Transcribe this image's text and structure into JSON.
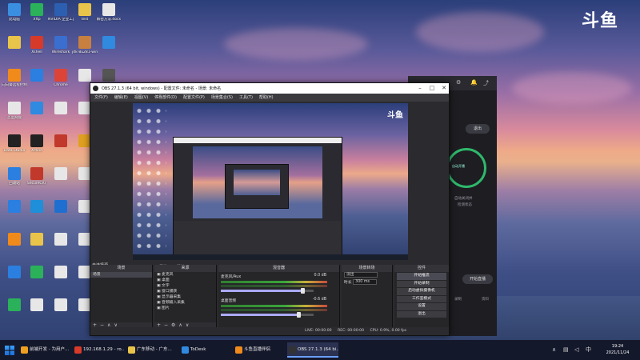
{
  "brand_logo": "斗鱼",
  "desktop_icons": [
    {
      "label": "此电脑",
      "color": "#3b8fe0"
    },
    {
      "label": "Xftp",
      "color": "#2bb15a"
    },
    {
      "label": "NVIDIA 企业工具",
      "color": "#2d5fb0"
    },
    {
      "label": "test",
      "color": "#e9c44a"
    },
    {
      "label": "解密方法.docx",
      "color": "#e7e7e7"
    },
    {
      "label": "",
      "color": "#e9c44a"
    },
    {
      "label": "Xshell",
      "color": "#d83a2a"
    },
    {
      "label": "Wireshark",
      "color": "#3a6fd0"
    },
    {
      "label": "jdk-8u281-windows",
      "color": "#c78040"
    },
    {
      "label": "",
      "color": "#2f8ae0"
    },
    {
      "label": "向日葵远程控制",
      "color": "#f08a1b"
    },
    {
      "label": "",
      "color": "#2a7fe0"
    },
    {
      "label": "Chrome",
      "color": "#db4437"
    },
    {
      "label": "",
      "color": "#e7e7e7"
    },
    {
      "label": "",
      "color": "#555"
    },
    {
      "label": "百度网盘",
      "color": "#e7e7e7"
    },
    {
      "label": "",
      "color": "#2f8ae0"
    },
    {
      "label": "",
      "color": "#e7e7e7"
    },
    {
      "label": "",
      "color": "#e7e7e7"
    },
    {
      "label": "",
      "color": "#555"
    },
    {
      "label": "Data Studio",
      "color": "#222"
    },
    {
      "label": "XMind",
      "color": "#222"
    },
    {
      "label": "",
      "color": "#c0392b"
    },
    {
      "label": "",
      "color": "#e0a020"
    },
    {
      "label": "",
      "color": "#555"
    },
    {
      "label": "回收站",
      "color": "#2a7fe0"
    },
    {
      "label": "SecureCRT",
      "color": "#c0392b"
    },
    {
      "label": "",
      "color": "#e7e7e7"
    },
    {
      "label": "",
      "color": "#e7e7e7"
    },
    {
      "label": "",
      "color": "#555"
    },
    {
      "label": "",
      "color": "#2a7fe0"
    },
    {
      "label": "",
      "color": "#1e8fd8"
    },
    {
      "label": "",
      "color": "#1e6fd0"
    },
    {
      "label": "",
      "color": "#e7e7e7"
    },
    {
      "label": "",
      "color": "#c0392b"
    },
    {
      "label": "",
      "color": "#f08a1b"
    },
    {
      "label": "",
      "color": "#e9c44a"
    },
    {
      "label": "",
      "color": "#e7e7e7"
    },
    {
      "label": "",
      "color": "#e7e7e7"
    },
    {
      "label": "",
      "color": "#555"
    },
    {
      "label": "",
      "color": "#2a7fe0"
    },
    {
      "label": "",
      "color": "#2bb15a"
    },
    {
      "label": "",
      "color": "#e7e7e7"
    },
    {
      "label": "",
      "color": "#e7e7e7"
    },
    {
      "label": "",
      "color": "#555"
    },
    {
      "label": "",
      "color": "#2bb15a"
    },
    {
      "label": "",
      "color": "#e7e7e7"
    },
    {
      "label": "",
      "color": "#e7e7e7"
    },
    {
      "label": "",
      "color": "#e7e7e7"
    },
    {
      "label": "",
      "color": "#1e6fd0"
    }
  ],
  "bg_app": {
    "quit_label": "退出",
    "ring_label": "自动开播",
    "line1": "自动关闭并",
    "line2": "检测状态",
    "start_label": "开始直播",
    "left_note": "录制",
    "right_note": "资料"
  },
  "obs": {
    "title": "OBS 27.1.3 (64 bit, windows) - 配置文件: 未命名 - 场景: 未命名",
    "menu": [
      "文件(F)",
      "编辑(E)",
      "视图(V)",
      "停靠部件(D)",
      "配置文件(P)",
      "场景集合(S)",
      "工具(T)",
      "帮助(H)"
    ],
    "preview_logo": "斗鱼",
    "scene_bar_label": "未选择源",
    "source_tools": [
      "属性",
      "滤镜"
    ],
    "docks": {
      "scenes": {
        "title": "场景",
        "items": [
          "场景"
        ]
      },
      "sources": {
        "title": "来源",
        "items": [
          "麦克风",
          "桌面",
          "文字",
          "窗口捕获",
          "显示器采集",
          "音频输入采集",
          "图片"
        ]
      },
      "mixer": {
        "title": "混音器",
        "tracks": [
          {
            "name": "麦克风/Aux",
            "db": "0.0 dB",
            "level": 0.88
          },
          {
            "name": "桌面音频",
            "db": "-0.6 dB",
            "level": 0.84
          }
        ]
      },
      "transitions": {
        "title": "场景转场",
        "type_label": "淡出",
        "duration_label": "时长",
        "duration_value": "300 ms"
      },
      "controls": {
        "title": "控件",
        "buttons": [
          "开始推流",
          "开始录制",
          "启动虚拟摄像机",
          "工作室模式",
          "设置",
          "退出"
        ]
      }
    },
    "status": [
      "LIVE: 00:00:00",
      "REC: 00:00:00",
      "CPU: 0.9%, 0.00 fps"
    ]
  },
  "taskbar": {
    "items": [
      {
        "label": "前端开发 - 为用户...",
        "color": "#f0a020"
      },
      {
        "label": "192.168.1.29 - ro...",
        "color": "#d83a2a"
      },
      {
        "label": "广东移动 - 广东...",
        "color": "#e9c44a"
      },
      {
        "label": "ToDesk",
        "color": "#2f8ae0"
      },
      {
        "label": "斗鱼直播伴侣",
        "color": "#f08a1b"
      },
      {
        "label": "OBS 27.1.3 (64 bi...",
        "color": "#333"
      }
    ],
    "time": "19:24",
    "date": "2021/11/24"
  }
}
